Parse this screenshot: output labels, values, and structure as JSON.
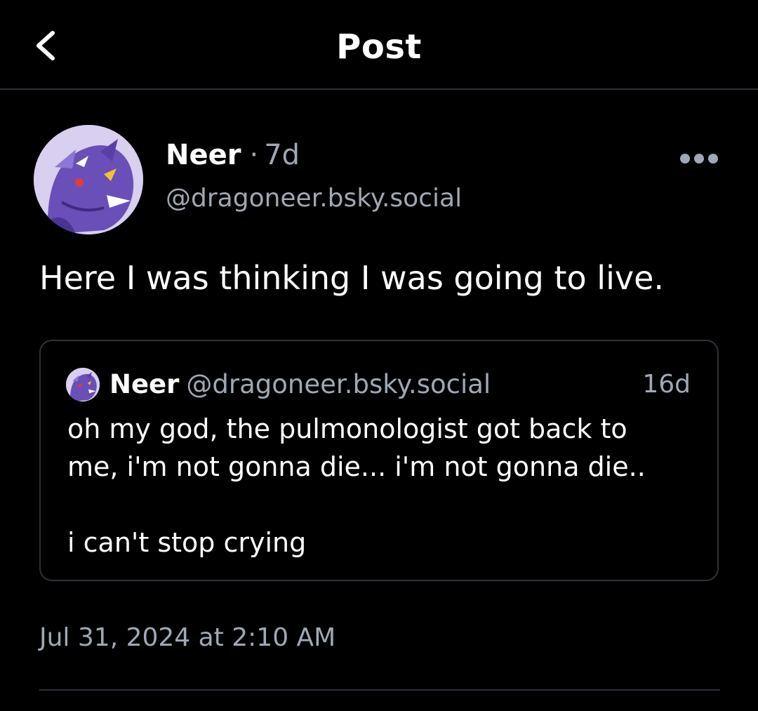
{
  "header": {
    "title": "Post",
    "back_icon": "chevron-left-icon"
  },
  "post": {
    "author_name": "Neer",
    "separator": "·",
    "age": "7d",
    "handle": "@dragoneer.bsky.social",
    "more_icon": "more-horizontal-icon",
    "text": "Here I was thinking I was going to live.",
    "timestamp": "Jul 31, 2024 at 2:10 AM"
  },
  "quote": {
    "author_name": "Neer",
    "handle": "@dragoneer.bsky.social",
    "age": "16d",
    "lines": [
      "oh my god, the pulmonologist got back to",
      "me, i'm not gonna die... i'm not gonna die..",
      "i can't stop crying"
    ]
  },
  "colors": {
    "background": "#000000",
    "primary_text": "#ffffff",
    "secondary_text": "#a0a8b5",
    "border": "#2e3239",
    "avatar_accent": "#6a4fb8"
  }
}
